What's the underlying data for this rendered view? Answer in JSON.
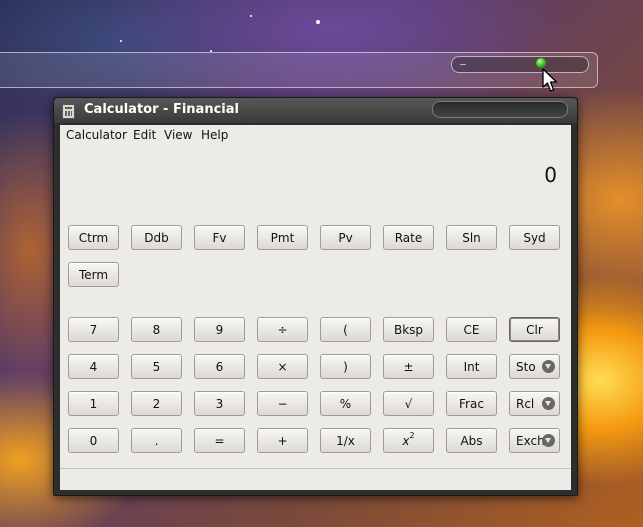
{
  "window": {
    "title": "Calculator - Financial"
  },
  "menu": [
    "Calculator",
    "Edit",
    "View",
    "Help"
  ],
  "display": {
    "value": "0"
  },
  "financial_buttons": [
    "Ctrm",
    "Ddb",
    "Fv",
    "Pmt",
    "Pv",
    "Rate",
    "Sln",
    "Syd",
    "Term"
  ],
  "keypad": {
    "row1": [
      "7",
      "8",
      "9",
      "÷",
      "(",
      "Bksp",
      "CE",
      "Clr"
    ],
    "row2": [
      "4",
      "5",
      "6",
      "×",
      ")",
      "±",
      "Int",
      "Sto"
    ],
    "row3": [
      "1",
      "2",
      "3",
      "−",
      "%",
      "√",
      "Frac",
      "Rcl"
    ],
    "row4": [
      "0",
      ".",
      "=",
      "+",
      "1/x",
      "x",
      "Abs",
      "Exch"
    ],
    "row4_sup": "2"
  }
}
